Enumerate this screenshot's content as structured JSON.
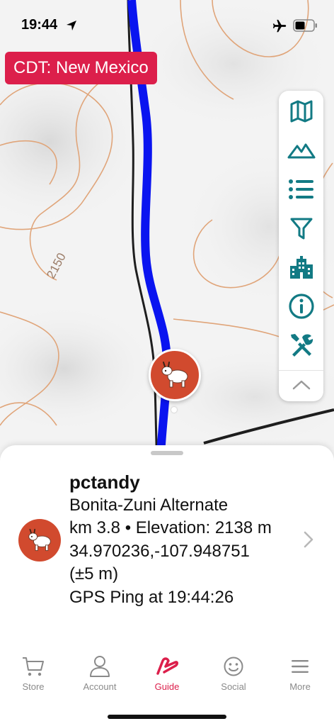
{
  "status_bar": {
    "time": "19:44",
    "icons": [
      "location-arrow-icon",
      "airplane-icon",
      "battery-icon"
    ]
  },
  "map": {
    "route_label": "CDT: New Mexico",
    "contour_label": "2150",
    "colors": {
      "route": "#0a14f0",
      "track": "#222222",
      "contour": "#e0a57a",
      "accent": "#dc1f4b",
      "tool_icons": "#127a84"
    }
  },
  "toolbar": {
    "buttons": [
      "map-icon",
      "mountains-icon",
      "list-icon",
      "filter-icon",
      "buildings-icon",
      "info-icon",
      "tools-icon",
      "chevron-up-icon"
    ]
  },
  "marker": {
    "icon": "goat-icon"
  },
  "sheet": {
    "user_name": "pctandy",
    "trail_name": "Bonita-Zuni Alternate",
    "km_elevation": "km 3.8 • Elevation: 2138 m",
    "coordinates": "34.970236,-107.948751",
    "accuracy": "(±5 m)",
    "ping": "GPS Ping at 19:44:26"
  },
  "tabs": [
    {
      "label": "Store",
      "icon": "cart-icon",
      "active": false
    },
    {
      "label": "Account",
      "icon": "person-icon",
      "active": false
    },
    {
      "label": "Guide",
      "icon": "guide-logo-icon",
      "active": true
    },
    {
      "label": "Social",
      "icon": "smiley-icon",
      "active": false
    },
    {
      "label": "More",
      "icon": "menu-icon",
      "active": false
    }
  ]
}
